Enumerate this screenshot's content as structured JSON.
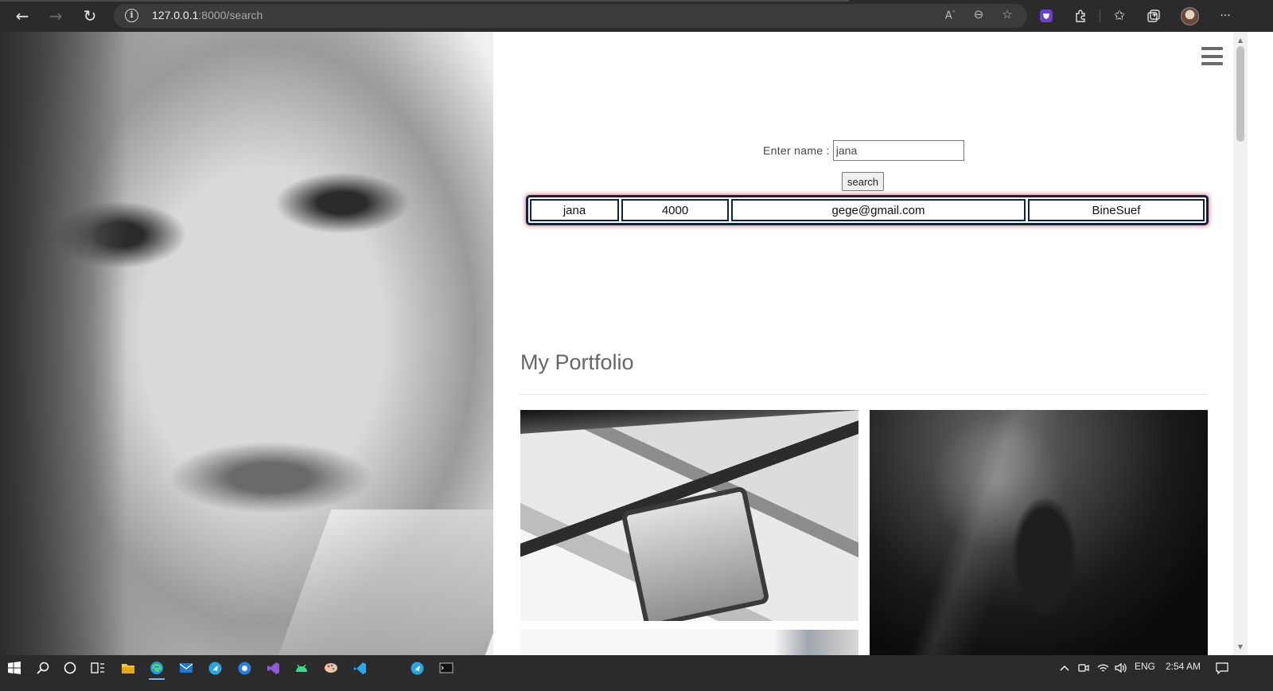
{
  "browser": {
    "url_host": "127.0.0.1",
    "url_rest": ":8000/search",
    "back_icon": "←",
    "forward_icon": "→",
    "reload_icon": "↻",
    "more_icon": "···"
  },
  "search": {
    "label": "Enter name :",
    "value": "jana",
    "button_label": "search"
  },
  "result": {
    "cells": [
      "jana",
      "4000",
      "gege@gmail.com",
      "BineSuef"
    ]
  },
  "portfolio": {
    "title": "My Portfolio"
  },
  "taskbar": {
    "language": "ENG",
    "time": "2:54 AM"
  },
  "colors": {
    "table_border": "#14213d",
    "table_glow": "#e4a4a4",
    "chrome_bg": "#2b2b2b"
  }
}
